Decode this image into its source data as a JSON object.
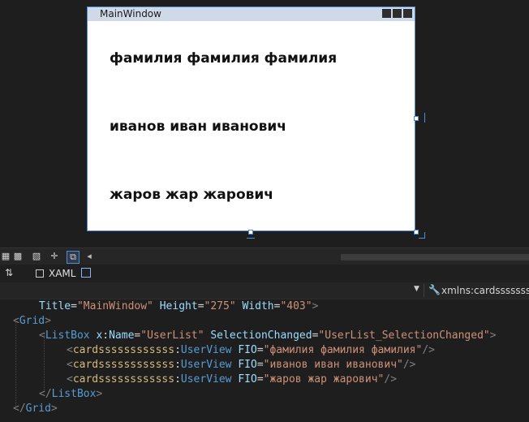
{
  "designer": {
    "window_title": "MainWindow",
    "cards": [
      "фамилия фамилия фамилия",
      "иванов иван иванович",
      "жаров жар жарович"
    ]
  },
  "tabs": {
    "xaml_label": "XAML"
  },
  "navbar": {
    "namespace": "xmlns:cardsssssssssss"
  },
  "code": {
    "title_attr": "Title",
    "title_val": "\"MainWindow\"",
    "height_attr": "Height",
    "height_val": "\"275\"",
    "width_attr": "Width",
    "width_val": "\"403\"",
    "grid": "Grid",
    "listbox": "ListBox",
    "x_prefix": "x",
    "name_attr": "Name",
    "name_val": "\"UserList\"",
    "sel_attr": "SelectionChanged",
    "sel_val": "\"UserList_SelectionChanged\"",
    "ns": "cardssssssssssss",
    "userview": "UserView",
    "fio_attr": "FIO",
    "fio_vals": [
      "\"фамилия фамилия фамилия\"",
      "\"иванов иван иванович\"",
      "\"жаров жар жарович\""
    ]
  },
  "colors": {
    "selection_accent": "#4c8cd6",
    "xml_tag": "#569cd6",
    "xml_attr": "#9cdcfe",
    "xml_value": "#ce9178"
  }
}
